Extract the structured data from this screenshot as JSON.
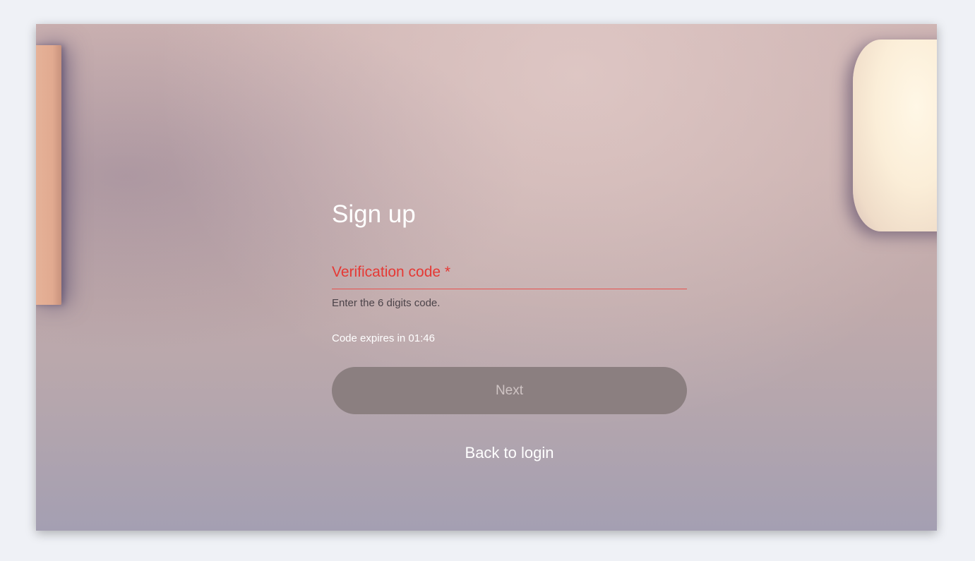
{
  "signup": {
    "title": "Sign up",
    "verification_label": "Verification code *",
    "verification_value": "",
    "helper_text": "Enter the 6 digits code.",
    "expiry_text": "Code expires in 01:46",
    "next_label": "Next",
    "back_label": "Back to login"
  },
  "colors": {
    "error": "#e53935",
    "button_bg": "#8b7f80",
    "button_text": "#cfc4c4",
    "page_bg": "#eff1f6"
  }
}
